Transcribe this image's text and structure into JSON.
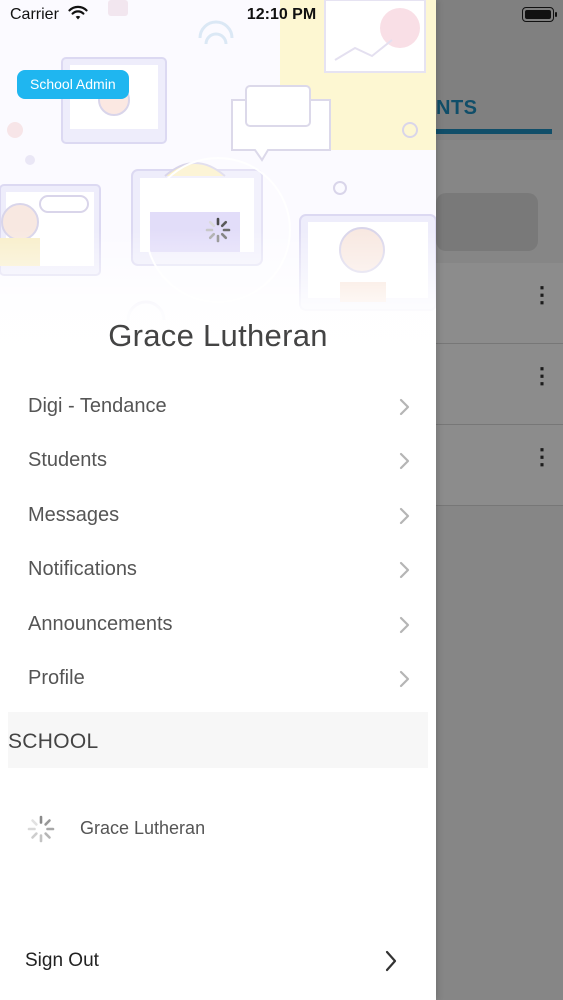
{
  "status_bar": {
    "carrier": "Carrier",
    "time": "12:10 PM",
    "wifi_icon": "wifi-icon",
    "battery_icon": "battery-icon"
  },
  "background": {
    "tab_label": "NTS",
    "row_menu_icon": "more-vertical-icon",
    "row_menu_glyph": "⋮"
  },
  "drawer": {
    "role_badge": "School Admin",
    "user_name": "Grace Lutheran",
    "avatar_icon": "loading-spinner-icon",
    "menu": [
      {
        "label": "Digi - Tendance",
        "icon": "chevron-right-icon"
      },
      {
        "label": "Students",
        "icon": "chevron-right-icon"
      },
      {
        "label": "Messages",
        "icon": "chevron-right-icon"
      },
      {
        "label": "Notifications",
        "icon": "chevron-right-icon"
      },
      {
        "label": "Announcements",
        "icon": "chevron-right-icon"
      },
      {
        "label": "Profile",
        "icon": "chevron-right-icon"
      }
    ],
    "section_title": "SCHOOL",
    "school": {
      "name": "Grace Lutheran",
      "icon": "loading-spinner-icon"
    },
    "sign_out": {
      "label": "Sign Out",
      "icon": "chevron-right-icon"
    }
  },
  "colors": {
    "badge": "#1fb6f0",
    "accent_blue": "#1e8fbf",
    "text_primary": "#444444",
    "text_menu": "#555555",
    "chevron": "#b5b5b5",
    "dim_overlay": "rgba(0,0,0,0.45)"
  }
}
